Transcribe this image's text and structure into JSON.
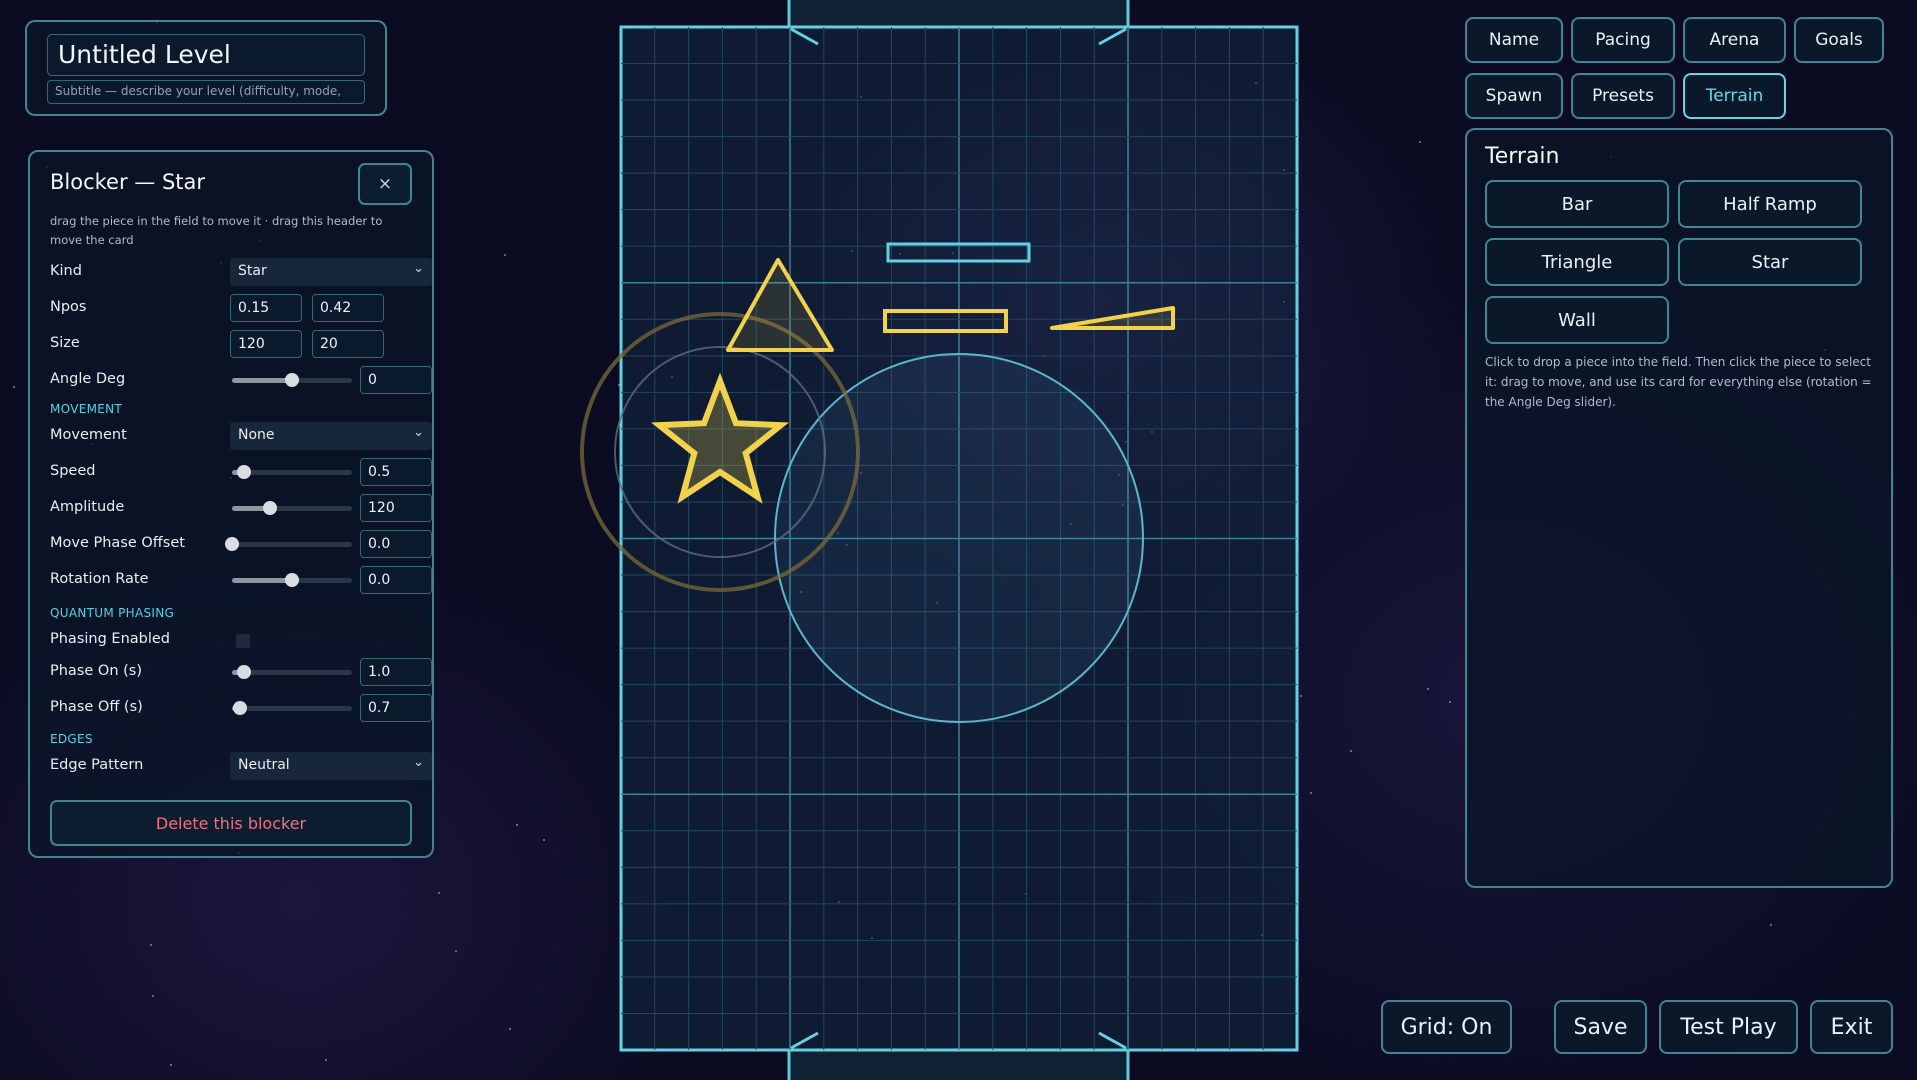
{
  "level": {
    "title": "Untitled Level",
    "subtitle_placeholder": "Subtitle — describe your level (difficulty, mode,"
  },
  "blocker_card": {
    "title": "Blocker — Star",
    "close_label": "×",
    "hint": "drag the piece in the field to move it · drag this header to move the card",
    "kind": {
      "label": "Kind",
      "value": "Star"
    },
    "npos": {
      "label": "Npos",
      "x": "0.15",
      "y": "0.42"
    },
    "size": {
      "label": "Size",
      "w": "120",
      "h": "20"
    },
    "angle": {
      "label": "Angle Deg",
      "value": "0",
      "slider": 0.5
    },
    "movement_section": "MOVEMENT",
    "movement": {
      "label": "Movement",
      "value": "None"
    },
    "speed": {
      "label": "Speed",
      "value": "0.5",
      "slider": 0.1
    },
    "amplitude": {
      "label": "Amplitude",
      "value": "120",
      "slider": 0.32
    },
    "phase_offset": {
      "label": "Move Phase Offset",
      "value": "0.0",
      "slider": 0.0
    },
    "rotation_rate": {
      "label": "Rotation Rate",
      "value": "0.0",
      "slider": 0.5
    },
    "quantum_section": "QUANTUM PHASING",
    "phasing_enabled": {
      "label": "Phasing Enabled",
      "checked": false
    },
    "phase_on": {
      "label": "Phase On (s)",
      "value": "1.0",
      "slider": 0.1
    },
    "phase_off": {
      "label": "Phase Off (s)",
      "value": "0.7",
      "slider": 0.07
    },
    "edges_section": "EDGES",
    "edge_pattern": {
      "label": "Edge Pattern",
      "value": "Neutral"
    },
    "delete_label": "Delete this blocker"
  },
  "tabs": [
    {
      "label": "Name",
      "active": false
    },
    {
      "label": "Pacing",
      "active": false
    },
    {
      "label": "Arena",
      "active": false
    },
    {
      "label": "Goals",
      "active": false
    },
    {
      "label": "Spawn",
      "active": false
    },
    {
      "label": "Presets",
      "active": false
    },
    {
      "label": "Terrain",
      "active": true
    }
  ],
  "terrain": {
    "title": "Terrain",
    "buttons": [
      "Bar",
      "Half Ramp",
      "Triangle",
      "Star",
      "Wall"
    ],
    "hint": "Click to drop a piece into the field. Then click the piece to select it: drag to move, and use its card for everything else (rotation = the Angle Deg slider)."
  },
  "bottom": {
    "grid": "Grid: On",
    "save": "Save",
    "test_play": "Test Play",
    "exit": "Exit"
  },
  "colors": {
    "accent": "#62d8e6",
    "panel_border": "#3f8592",
    "piece": "#f2d24a",
    "danger": "#ee6f86"
  },
  "icons": {
    "close": "close-icon",
    "dropdown": "chevron-down-icon"
  }
}
